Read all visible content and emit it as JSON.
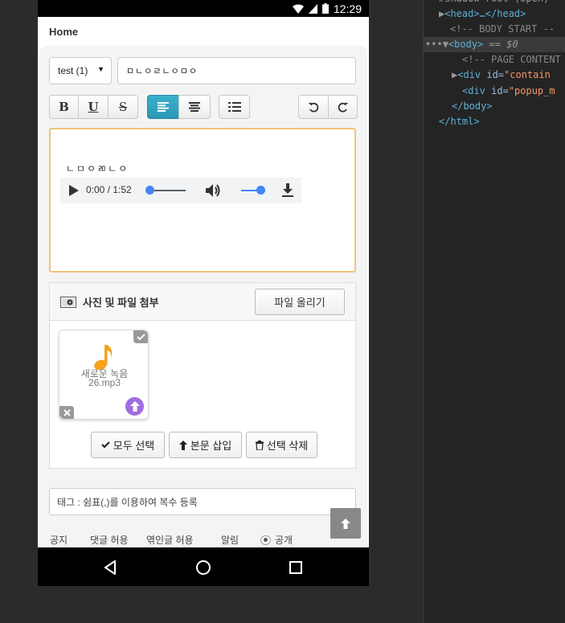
{
  "status_bar": {
    "time": "12:29"
  },
  "app_bar": {
    "title": "Home"
  },
  "form": {
    "category_select": "test (1)",
    "title_value": "ㅁㄴㅇㄹㄴㅇㅁㅇ",
    "editor_text": "ㄴㅁㅇㄻㄴㅇ",
    "audio": {
      "time": "0:00 / 1:52",
      "progress": 0.0,
      "volume": 1.0
    }
  },
  "toolbar": {
    "bold": "B",
    "underline": "U",
    "strike": "S",
    "align_left_active": true
  },
  "attach": {
    "title": "사진 및 파일 첨부",
    "upload_button": "파일 올리기",
    "file": {
      "name_line1": "새로운 녹음",
      "name_line2": "26.mp3",
      "icon": "music-note-icon"
    },
    "select_all": "모두 선택",
    "insert_body": "본문 삽입",
    "delete_selected": "선택 삭제"
  },
  "tags": {
    "placeholder": "태그 : 쉼표(,)를 이용하여 복수 등록"
  },
  "options": {
    "notice": "공지",
    "allow_comments": "댓글 허용",
    "allow_linked": "엮인글 허용",
    "alert": "알림",
    "public": "공개"
  },
  "colors": {
    "accent_blue": "#2a9fbc",
    "editor_border": "#f0c27b",
    "upload_purple": "#a06ee0",
    "note_orange": "#f6a21a",
    "audio_blue": "#4285f4"
  },
  "devtools": {
    "l1": "#shadow-root (open)",
    "l2_tag": "<head>…</head>",
    "l3": "<!-- BODY START --",
    "l4_tag": "<body>",
    "l4_ref": "== $0",
    "l5": "<!-- PAGE CONTENT",
    "l6_tag": "<div ",
    "l6_attr": "id=",
    "l6_val": "\"contain",
    "l7_tag": "<div ",
    "l7_attr": "id=",
    "l7_val": "\"popup_m",
    "l8": "</body>",
    "l9": "</html>"
  }
}
